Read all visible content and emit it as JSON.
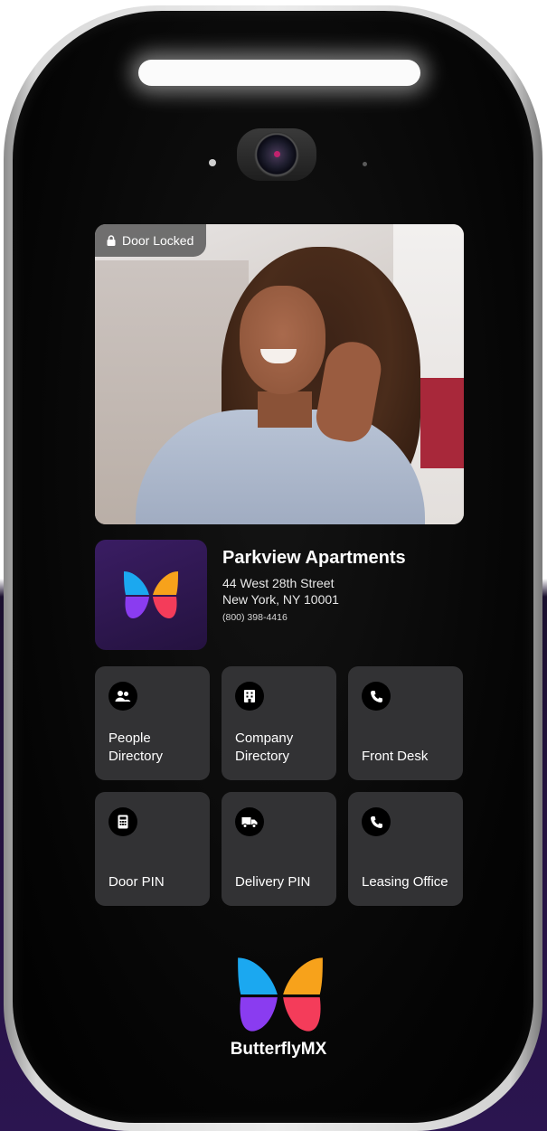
{
  "status": {
    "lock_label": "Door Locked"
  },
  "property": {
    "name": "Parkview Apartments",
    "address_line1": "44 West 28th Street",
    "address_line2": "New York, NY 10001",
    "phone": "(800) 398-4416"
  },
  "menu": {
    "tiles": [
      {
        "label": "People Directory",
        "icon": "people-icon"
      },
      {
        "label": "Company Directory",
        "icon": "building-icon"
      },
      {
        "label": "Front Desk",
        "icon": "phone-icon"
      },
      {
        "label": "Door PIN",
        "icon": "keypad-icon"
      },
      {
        "label": "Delivery PIN",
        "icon": "truck-icon"
      },
      {
        "label": "Leasing Office",
        "icon": "phone-icon"
      }
    ]
  },
  "brand": {
    "name": "ButterflyMX"
  },
  "colors": {
    "device": "#000000",
    "tile": "#323234",
    "logo_tile": "#2e1750",
    "butterfly_blue": "#1ba8f0",
    "butterfly_orange": "#f7a21b",
    "butterfly_purple": "#8a3cf0",
    "butterfly_red": "#f43c5a"
  }
}
